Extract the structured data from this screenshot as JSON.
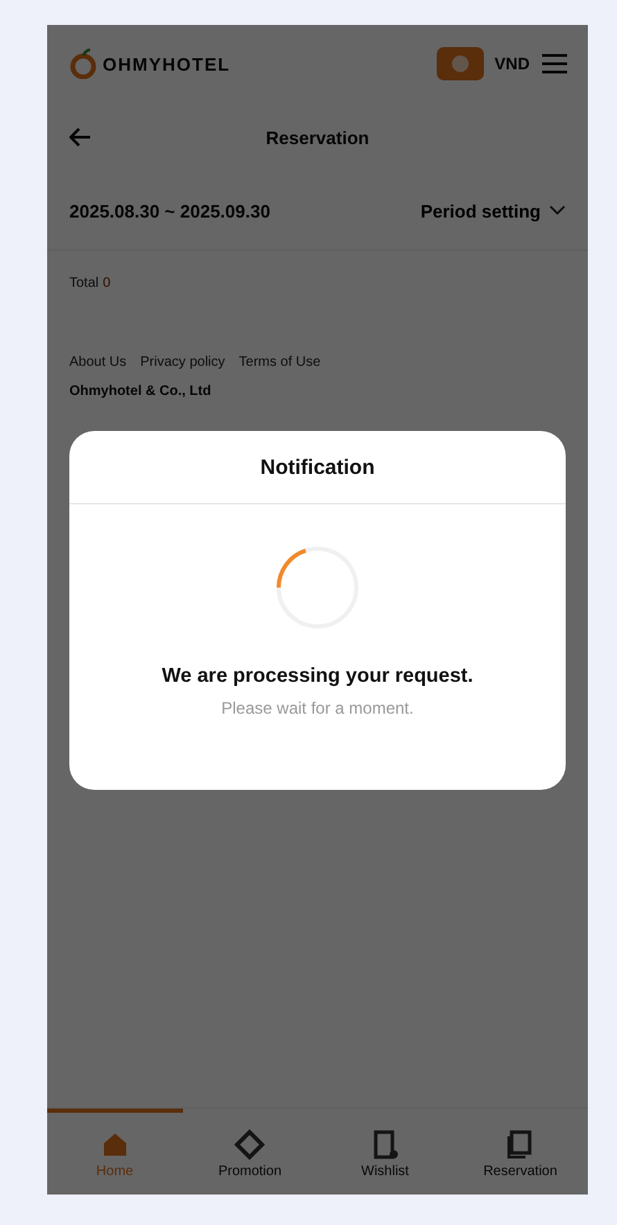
{
  "header": {
    "logo": "OHMYHOTEL",
    "currency": "VND"
  },
  "page": {
    "title": "Reservation",
    "period": "2025.08.30 ~ 2025.09.30",
    "period_button": "Period setting",
    "total_label": "Total",
    "total_count": "0"
  },
  "footer": {
    "links": [
      "About Us",
      "Privacy policy",
      "Terms of Use"
    ],
    "company": "Ohmyhotel & Co., Ltd"
  },
  "tabs": [
    {
      "label": "Home",
      "kind": "home",
      "selected": true
    },
    {
      "label": "Promotion",
      "kind": "promotion",
      "selected": false
    },
    {
      "label": "Wishlist",
      "kind": "wishlist",
      "selected": false
    },
    {
      "label": "Reservation",
      "kind": "reservation",
      "selected": false
    }
  ],
  "dialog": {
    "title": "Notification",
    "message": "We are processing your request.",
    "hint": "Please wait for a moment.",
    "progress": {
      "level": 0.2
    }
  }
}
